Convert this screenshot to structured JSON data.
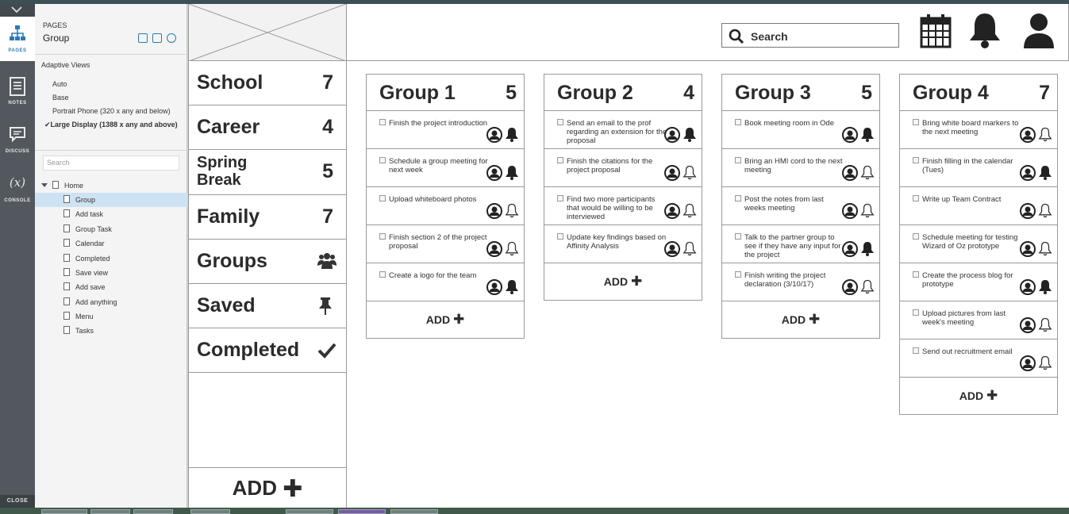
{
  "rail": {
    "tabs": [
      {
        "label": "PAGES"
      },
      {
        "label": "NOTES"
      },
      {
        "label": "DISCUSS"
      },
      {
        "label": "CONSOLE",
        "glyph": "(x)"
      }
    ],
    "close_label": "CLOSE"
  },
  "pages_panel": {
    "title": "PAGES",
    "current_page": "Group",
    "adaptive_title": "Adaptive Views",
    "adaptive_views": [
      "Auto",
      "Base",
      "Portrait Phone (320 x any and below)"
    ],
    "adaptive_selected": "Large Display (1388 x any and above)",
    "search_placeholder": "Search",
    "tree_root": "Home",
    "tree": [
      "Group",
      "Add task",
      "Group Task",
      "Calendar",
      "Completed",
      "Save view",
      "Add save",
      "Add anything",
      "Menu",
      "Tasks"
    ]
  },
  "categories": [
    {
      "name": "School",
      "count": "7"
    },
    {
      "name": "Career",
      "count": "4"
    },
    {
      "name": "Spring Break",
      "count": "5"
    },
    {
      "name": "Family",
      "count": "7"
    },
    {
      "name": "Groups",
      "icon": "group-icon"
    },
    {
      "name": "Saved",
      "icon": "pin-icon"
    },
    {
      "name": "Completed",
      "icon": "checkmark-icon"
    }
  ],
  "category_add_label": "ADD",
  "header": {
    "search_label": "Search",
    "icons": [
      "calendar-icon",
      "bell-icon",
      "user-icon"
    ]
  },
  "groups": [
    {
      "name": "Group 1",
      "count": "5",
      "tasks": [
        {
          "text": "Finish the project introduction",
          "bell": "filled"
        },
        {
          "text": " Schedule a group meeting for next week",
          "bell": "filled"
        },
        {
          "text": "Upload whiteboard photos",
          "bell": "outline"
        },
        {
          "text": "Finish section 2 of the project proposal",
          "bell": "outline"
        },
        {
          "text": "Create a logo for the team",
          "bell": "filled"
        }
      ]
    },
    {
      "name": "Group 2",
      "count": "4",
      "tasks": [
        {
          "text": "Send an email to the prof regarding an extension for the proposal",
          "bell": "filled"
        },
        {
          "text": "Finish the citations for the project proposal",
          "bell": "outline"
        },
        {
          "text": "Find two more participants that would be willing to be interviewed",
          "bell": "outline"
        },
        {
          "text": "Update key findings based on Affinity Analysis",
          "bell": "outline"
        }
      ]
    },
    {
      "name": "Group 3",
      "count": "5",
      "tasks": [
        {
          "text": "Book meeting room in Ode",
          "bell": "filled"
        },
        {
          "text": "Bring an HMI cord to the next meeting",
          "bell": "outline"
        },
        {
          "text": "Post the notes from last weeks meeting",
          "bell": "outline"
        },
        {
          "text": "Talk to the partner group to see if they have any input for the project",
          "bell": "filled"
        },
        {
          "text": "Finish writing the project declaration (3/10/17)",
          "bell": "outline"
        }
      ]
    },
    {
      "name": "Group 4",
      "count": "7",
      "tasks": [
        {
          "text": "Bring white board markers to the next meeting",
          "bell": "outline"
        },
        {
          "text": "Finish filling in the calendar (Tues)",
          "bell": "filled"
        },
        {
          "text": "Write up Team Contract",
          "bell": "outline"
        },
        {
          "text": "Schedule meeting for testing Wizard of Oz prototype",
          "bell": "outline"
        },
        {
          "text": "Create the process blog for prototype",
          "bell": "filled"
        },
        {
          "text": "Upload pictures from last week's meeting",
          "bell": "outline"
        },
        {
          "text": "Send out recruitment email",
          "bell": "outline"
        }
      ]
    }
  ],
  "group_add_label": "ADD"
}
